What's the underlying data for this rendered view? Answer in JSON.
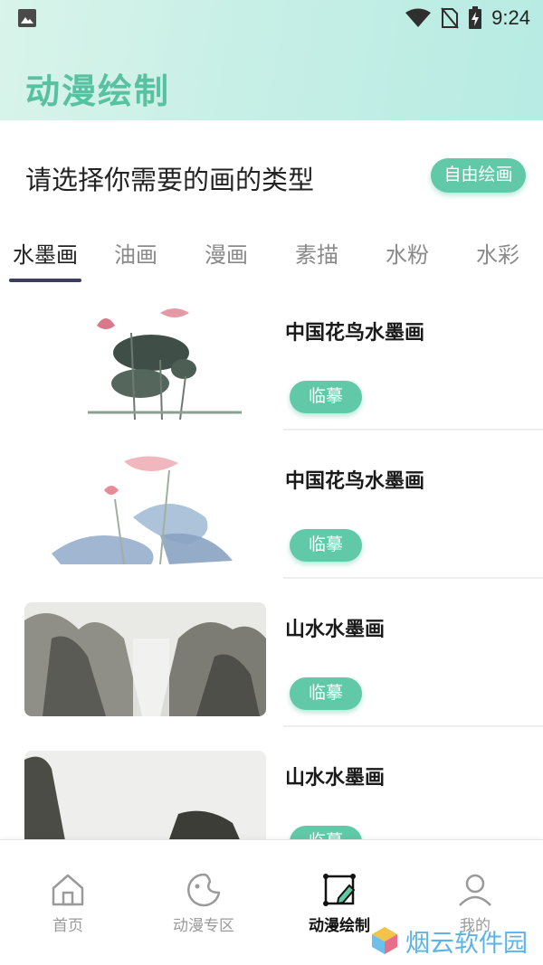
{
  "status": {
    "time": "9:24"
  },
  "app": {
    "title": "动漫绘制"
  },
  "prompt": {
    "text": "请选择你需要的画的类型",
    "free_button": "自由绘画"
  },
  "tabs": [
    {
      "label": "水墨画",
      "active": true
    },
    {
      "label": "油画",
      "active": false
    },
    {
      "label": "漫画",
      "active": false
    },
    {
      "label": "素描",
      "active": false
    },
    {
      "label": "水粉",
      "active": false
    },
    {
      "label": "水彩",
      "active": false
    }
  ],
  "cards": [
    {
      "title": "中国花鸟水墨画",
      "button": "临摹"
    },
    {
      "title": "中国花鸟水墨画",
      "button": "临摹"
    },
    {
      "title": "山水水墨画",
      "button": "临摹"
    },
    {
      "title": "山水水墨画",
      "button": "临摹"
    }
  ],
  "nav": [
    {
      "label": "首页",
      "icon": "home-icon",
      "active": false
    },
    {
      "label": "动漫专区",
      "icon": "palette-icon",
      "active": false
    },
    {
      "label": "动漫绘制",
      "icon": "draw-icon",
      "active": true
    },
    {
      "label": "我的",
      "icon": "user-icon",
      "active": false
    }
  ],
  "watermark": {
    "text": "烟云软件园"
  },
  "colors": {
    "accent": "#62c9a8",
    "title": "#57c1a1",
    "tab_underline": "#3b3f5c"
  }
}
